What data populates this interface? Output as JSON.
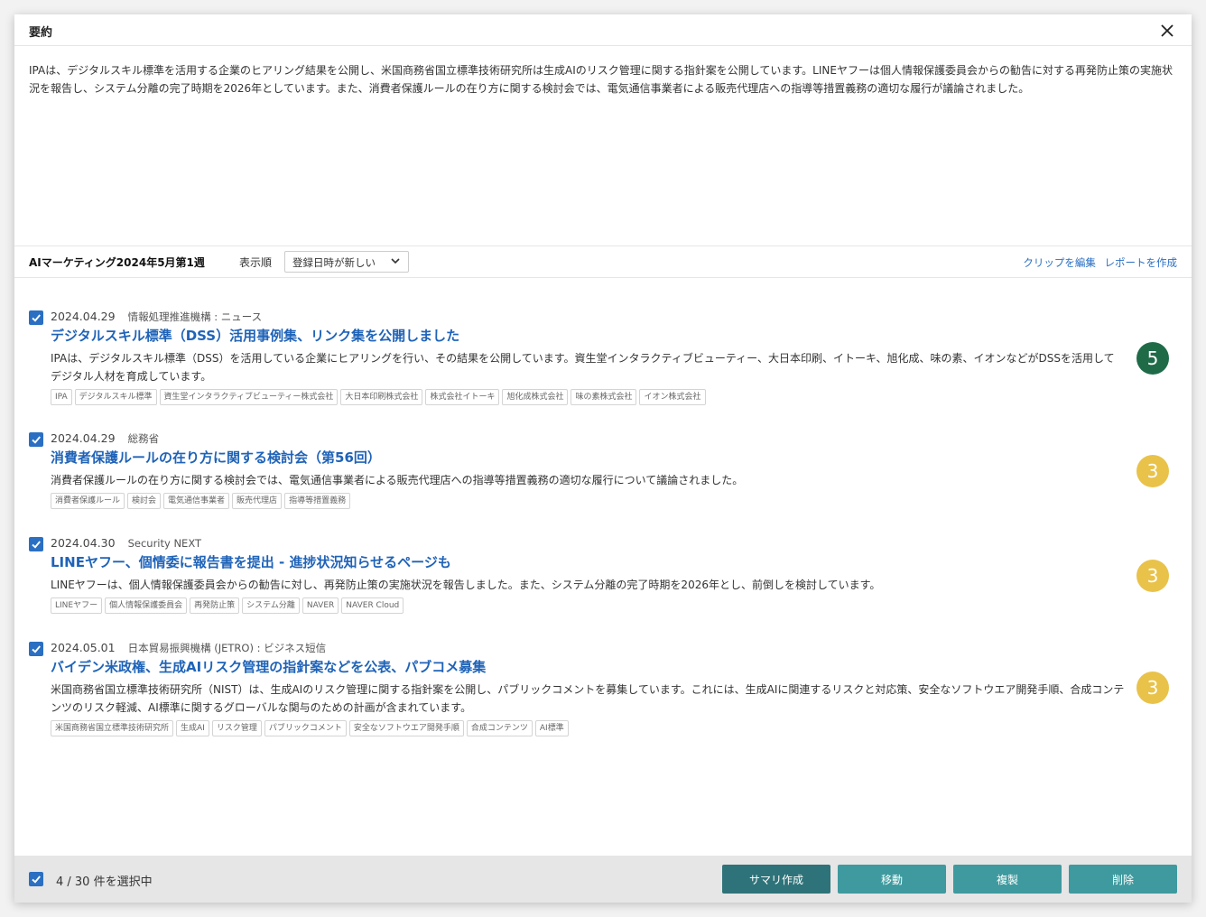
{
  "dialog": {
    "title": "要約",
    "summary": "IPAは、デジタルスキル標準を活用する企業のヒアリング結果を公開し、米国商務省国立標準技術研究所は生成AIのリスク管理に関する指針案を公開しています。LINEヤフーは個人情報保護委員会からの勧告に対する再発防止策の実施状況を報告し、システム分離の完了時期を2026年としています。また、消費者保護ルールの在り方に関する検討会では、電気通信事業者による販売代理店への指導等措置義務の適切な履行が議論されました。"
  },
  "toolbar": {
    "clip_name": "AIマーケティング2024年5月第1週",
    "sort_label": "表示順",
    "sort_value": "登録日時が新しい",
    "edit_clip": "クリップを編集",
    "create_report": "レポートを作成"
  },
  "items": [
    {
      "checked": true,
      "date": "2024.04.29",
      "source": "情報処理推進機構 : ニュース",
      "title": "デジタルスキル標準（DSS）活用事例集、リンク集を公開しました",
      "description": "IPAは、デジタルスキル標準（DSS）を活用している企業にヒアリングを行い、その結果を公開しています。資生堂インタラクティブビューティー、大日本印刷、イトーキ、旭化成、味の素、イオンなどがDSSを活用してデジタル人材を育成しています。",
      "tags": [
        "IPA",
        "デジタルスキル標準",
        "資生堂インタラクティブビューティー株式会社",
        "大日本印刷株式会社",
        "株式会社イトーキ",
        "旭化成株式会社",
        "味の素株式会社",
        "イオン株式会社"
      ],
      "score": "5",
      "score_color": "#1f6b48"
    },
    {
      "checked": true,
      "date": "2024.04.29",
      "source": "総務省",
      "title": "消費者保護ルールの在り方に関する検討会（第56回）",
      "description": "消費者保護ルールの在り方に関する検討会では、電気通信事業者による販売代理店への指導等措置義務の適切な履行について議論されました。",
      "tags": [
        "消費者保護ルール",
        "検討会",
        "電気通信事業者",
        "販売代理店",
        "指導等措置義務"
      ],
      "score": "3",
      "score_color": "#e9c24a"
    },
    {
      "checked": true,
      "date": "2024.04.30",
      "source": "Security NEXT",
      "title": "LINEヤフー、個情委に報告書を提出 - 進捗状況知らせるページも",
      "description": "LINEヤフーは、個人情報保護委員会からの勧告に対し、再発防止策の実施状況を報告しました。また、システム分離の完了時期を2026年とし、前倒しを検討しています。",
      "tags": [
        "LINEヤフー",
        "個人情報保護委員会",
        "再発防止策",
        "システム分離",
        "NAVER",
        "NAVER Cloud"
      ],
      "score": "3",
      "score_color": "#e9c24a"
    },
    {
      "checked": true,
      "date": "2024.05.01",
      "source": "日本貿易振興機構 (JETRO) : ビジネス短信",
      "title": "バイデン米政権、生成AIリスク管理の指針案などを公表、パブコメ募集",
      "description": "米国商務省国立標準技術研究所（NIST）は、生成AIのリスク管理に関する指針案を公開し、パブリックコメントを募集しています。これには、生成AIに関連するリスクと対応策、安全なソフトウエア開発手順、合成コンテンツのリスク軽減、AI標準に関するグローバルな関与のための計画が含まれています。",
      "tags": [
        "米国商務省国立標準技術研究所",
        "生成AI",
        "リスク管理",
        "パブリックコメント",
        "安全なソフトウエア開発手順",
        "合成コンテンツ",
        "AI標準"
      ],
      "score": "3",
      "score_color": "#e9c24a"
    }
  ],
  "footer": {
    "selection_count": "4 / 30 件を選択中",
    "summarize_label": "サマリ作成",
    "move_label": "移動",
    "copy_label": "複製",
    "delete_label": "削除",
    "summarize_color": "#2e7379",
    "button_color": "#3e9a9e"
  }
}
